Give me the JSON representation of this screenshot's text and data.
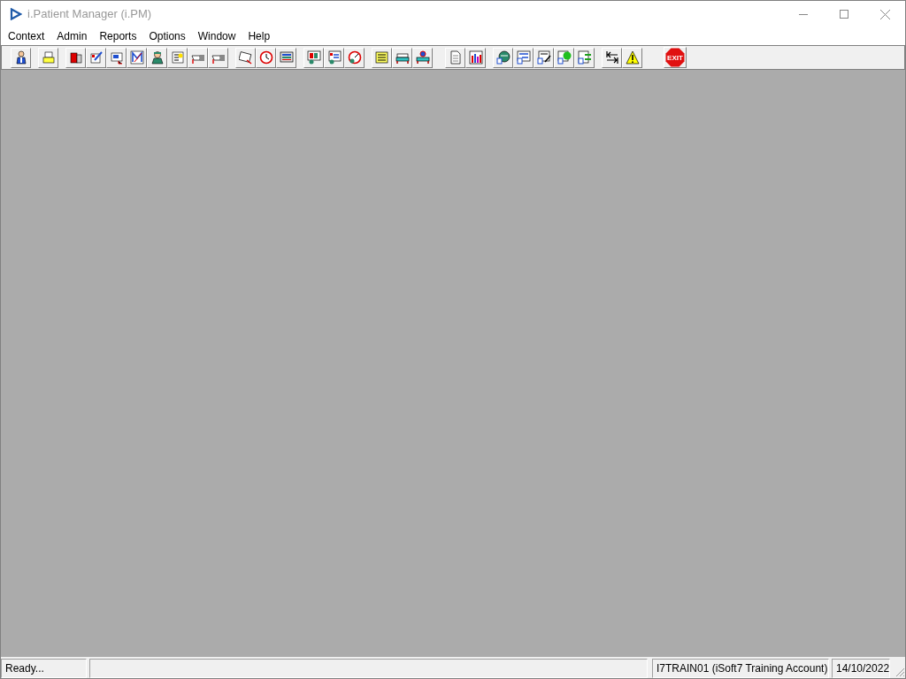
{
  "window": {
    "title": "i.Patient Manager (i.PM)"
  },
  "menu": [
    "Context",
    "Admin",
    "Reports",
    "Options",
    "Window",
    "Help"
  ],
  "toolbar": {
    "exit_label": "EXIT"
  },
  "status_bar": {
    "message": "Ready...",
    "account": "I7TRAIN01 (iSoft7 Training Account)",
    "date": "14/10/2022"
  }
}
